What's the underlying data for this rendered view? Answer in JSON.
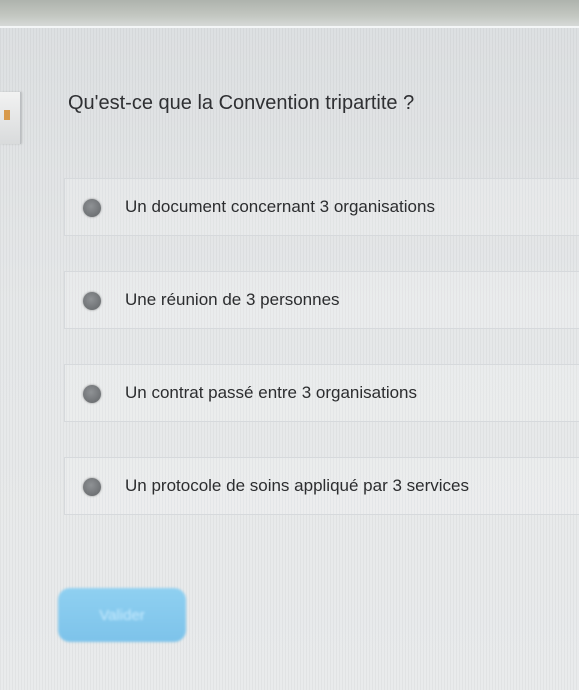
{
  "question": {
    "title": "Qu'est-ce que la Convention tripartite ?"
  },
  "options": [
    {
      "label": "Un document concernant 3 organisations"
    },
    {
      "label": "Une réunion de 3 personnes"
    },
    {
      "label": "Un contrat passé entre 3 organisations"
    },
    {
      "label": "Un protocole de soins appliqué par 3 services"
    }
  ],
  "actions": {
    "submit_label": "Valider"
  },
  "colors": {
    "accent": "#7dc3ea",
    "radio": "#6f7275",
    "text": "#2c2d2f"
  }
}
